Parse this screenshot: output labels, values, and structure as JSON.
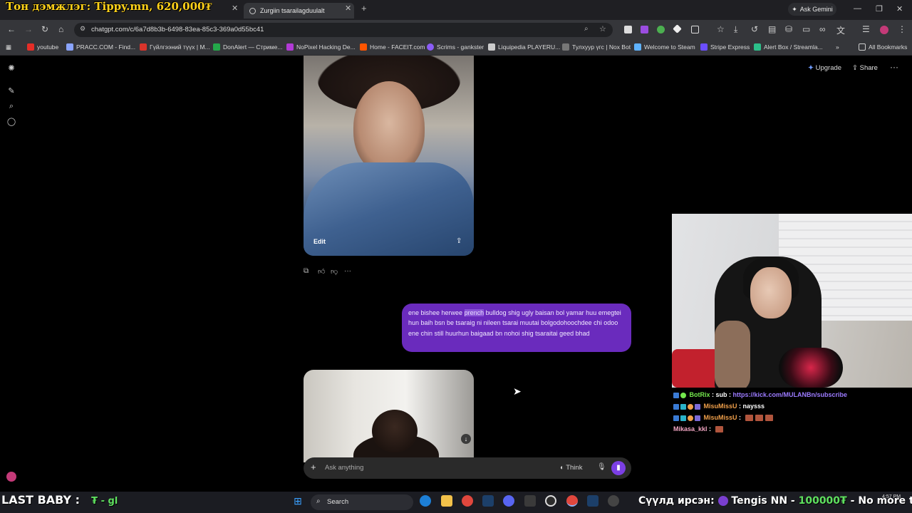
{
  "browser": {
    "overlay_banner": "Тон дэмжлэг: Tippy.mn, 620,000₮",
    "tab_active": "Zurgiin tsarailagduulalt",
    "gemini_label": "Ask Gemini",
    "url": "chatgpt.com/c/6a7d8b3b-6498-83ea-85c3-369a0d55bc41",
    "bookmarks": [
      "youtube",
      "PRACC.COM - Find...",
      "Гүйлгээний түүх | M...",
      "DonAlert — Стриме...",
      "NoPixel Hacking De...",
      "Home - FACEIT.com",
      "Scrims - gankster",
      "Liquipedia PLAYERU...",
      "Тулхуур үгс | Nox Bot",
      "Welcome to Steam",
      "Stripe Express",
      "Alert Box / Streamla..."
    ],
    "all_bookmarks": "All Bookmarks"
  },
  "header": {
    "upgrade_label": "Upgrade",
    "share_label": "Share"
  },
  "image_card": {
    "edit_label": "Edit"
  },
  "message": {
    "before": "ene bishee herwee ",
    "highlight": "prench",
    "after": " bulldog shig ugly baisan bol yamar huu emegtei hun baih bsn be tsaraig ni nileen tsarai muutai bolgodohoochdee chi odoo ene chin still huurhun baigaad bn nohoi shig tsaraitai geed bhad"
  },
  "composer": {
    "placeholder": "Ask anything",
    "think_label": "Think"
  },
  "stream_chat": [
    {
      "user": "BotRix",
      "sep": " : ",
      "msg": "sub : ",
      "link": "https://kick.com/MULANBn/subscribe"
    },
    {
      "user": "MisuMissU",
      "sep": " : ",
      "msg": "naysss"
    },
    {
      "user": "MisuMissU",
      "sep": " : ",
      "msg": ""
    },
    {
      "user": "Mikasa_kkl",
      "sep": " : ",
      "msg": ""
    }
  ],
  "stream_overlay": {
    "last_baby": "LAST BABY :",
    "last_baby_val": "₮ - gl",
    "donate_label": "Сүүлд ирсэн:",
    "donate_name": "Tengis NN - ",
    "donate_amount": "100000₮",
    "donate_note": " - No more tippy"
  },
  "taskbar": {
    "search_label": "Search",
    "time": "4:57 PM"
  },
  "colors": {
    "bubble": "#6a2bbd",
    "accent_voice": "#7b3fe4"
  }
}
